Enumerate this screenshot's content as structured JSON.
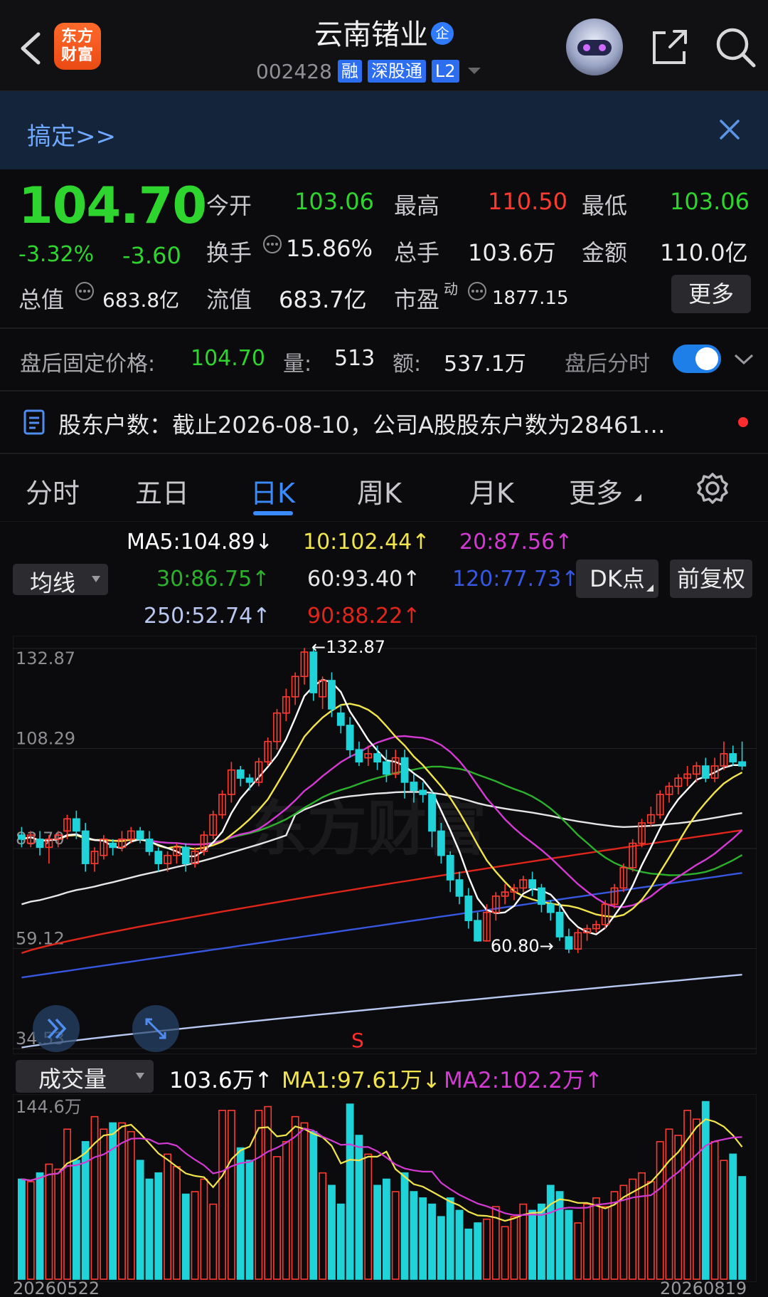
{
  "header": {
    "logo_text": "东方财富",
    "stock_name": "云南锗业",
    "qi_badge": "企",
    "code": "002428",
    "tags": [
      "融",
      "深股通",
      "L2"
    ]
  },
  "banner": {
    "text": "搞定>>"
  },
  "quote": {
    "price": "104.70",
    "change_pct": "-3.32%",
    "change": "-3.60",
    "open_label": "今开",
    "open": "103.06",
    "high_label": "最高",
    "high": "110.50",
    "low_label": "最低",
    "low": "103.06",
    "turnover_label": "换手",
    "turnover": "15.86%",
    "volume_label": "总手",
    "volume": "103.6万",
    "amount_label": "金额",
    "amount": "110.0亿",
    "mktcap_label": "总值",
    "mktcap": "683.8亿",
    "float_label": "流值",
    "float": "683.7亿",
    "pe_label": "市盈",
    "pe_sup": "动",
    "pe": "1877.15",
    "more_label": "更多"
  },
  "after_hours": {
    "label": "盘后固定价格:",
    "price": "104.70",
    "vol_label": "量:",
    "vol": "513",
    "amt_label": "额:",
    "amt": "537.1万",
    "tick_label": "盘后分时"
  },
  "notice": {
    "text": "股东户数：截止2026-08-10，公司A股股东户数为28461…"
  },
  "tabs": [
    "分时",
    "五日",
    "日K",
    "周K",
    "月K",
    "更多"
  ],
  "ma_selector": "均线",
  "ma_values": {
    "ma5": "MA5:104.89↓",
    "ma10": "10:102.44↑",
    "ma20": "20:87.56↑",
    "ma30": "30:86.75↑",
    "ma60": "60:93.40↑",
    "ma120": "120:77.73↑",
    "ma250": "250:52.74↑",
    "ma90": "90:88.22↑"
  },
  "buttons": {
    "dk": "DK点",
    "adjust": "前复权"
  },
  "volume_panel": {
    "selector": "成交量",
    "value": "103.6万↑",
    "ma1": "MA1:97.61万↓",
    "ma2": "MA2:102.2万↑",
    "max_label": "144.6万"
  },
  "colors": {
    "up": "#ff3b30",
    "down": "#1fd3d8",
    "ma5": "#ffffff",
    "ma10": "#f2e44c",
    "ma20": "#d33ad3",
    "ma30": "#2bb12b",
    "ma60": "#e6e6e6",
    "ma90": "#e0261a",
    "ma120": "#3657e0",
    "ma250": "#b8c8f0",
    "accent": "#3a8bff"
  },
  "chart_data": {
    "type": "candlestick",
    "y_ticks": [
      "132.87",
      "108.29",
      "83.70",
      "59.12",
      "34.53"
    ],
    "ylim": [
      34.53,
      132.87
    ],
    "x_labels": [
      "20260522",
      "20260819"
    ],
    "annotations": {
      "max": "←132.87",
      "min": "60.80→",
      "signal": "S"
    },
    "candles": [
      [
        87,
        86,
        89,
        84
      ],
      [
        85,
        87,
        88,
        84
      ],
      [
        86,
        84,
        88,
        82
      ],
      [
        84,
        86,
        87,
        80
      ],
      [
        86,
        87,
        88,
        84
      ],
      [
        88,
        91,
        92,
        86
      ],
      [
        91,
        88,
        93,
        86
      ],
      [
        88,
        80,
        90,
        78
      ],
      [
        80,
        83,
        84,
        78
      ],
      [
        82,
        86,
        87,
        81
      ],
      [
        85,
        84,
        86,
        82
      ],
      [
        84,
        86,
        88,
        83
      ],
      [
        86,
        88,
        89,
        85
      ],
      [
        88,
        86,
        89,
        85
      ],
      [
        86,
        83,
        88,
        82
      ],
      [
        83,
        80,
        84,
        78
      ],
      [
        80,
        82,
        83,
        78
      ],
      [
        82,
        84,
        85,
        80
      ],
      [
        84,
        80,
        85,
        78
      ],
      [
        80,
        83,
        84,
        79
      ],
      [
        83,
        87,
        88,
        82
      ],
      [
        87,
        92,
        93,
        86
      ],
      [
        92,
        97,
        98,
        91
      ],
      [
        97,
        103,
        105,
        95
      ],
      [
        103,
        101,
        104,
        99
      ],
      [
        101,
        100,
        102,
        98
      ],
      [
        100,
        105,
        106,
        99
      ],
      [
        105,
        110,
        111,
        104
      ],
      [
        110,
        117,
        118,
        108
      ],
      [
        117,
        121,
        123,
        115
      ],
      [
        121,
        126,
        127,
        119
      ],
      [
        126,
        132,
        133,
        124
      ],
      [
        132,
        122,
        133,
        120
      ],
      [
        121,
        125,
        126,
        118
      ],
      [
        125,
        118,
        127,
        116
      ],
      [
        117,
        114,
        119,
        112
      ],
      [
        114,
        108,
        116,
        106
      ],
      [
        108,
        105,
        110,
        104
      ],
      [
        106,
        107,
        109,
        104
      ],
      [
        107,
        105,
        109,
        103
      ],
      [
        105,
        102,
        108,
        100
      ],
      [
        102,
        106,
        108,
        101
      ],
      [
        106,
        100,
        108,
        96
      ],
      [
        100,
        98,
        102,
        95
      ],
      [
        98,
        97,
        100,
        95
      ],
      [
        97,
        88,
        98,
        84
      ],
      [
        88,
        82,
        90,
        80
      ],
      [
        82,
        76,
        83,
        73
      ],
      [
        76,
        72,
        78,
        70
      ],
      [
        72,
        66,
        74,
        64
      ],
      [
        66,
        61,
        68,
        60.8
      ],
      [
        61,
        68,
        70,
        60.8
      ],
      [
        68,
        72,
        73,
        66
      ],
      [
        72,
        73,
        75,
        70
      ],
      [
        73,
        74,
        75,
        71
      ],
      [
        74,
        76,
        77,
        73
      ],
      [
        76,
        74,
        78,
        72
      ],
      [
        74,
        70,
        75,
        68
      ],
      [
        70,
        68,
        71,
        66
      ],
      [
        68,
        62,
        70,
        61
      ],
      [
        62,
        59,
        64,
        58
      ],
      [
        59,
        63,
        64,
        58
      ],
      [
        63,
        64,
        65,
        61
      ],
      [
        64,
        65,
        66,
        63
      ],
      [
        65,
        70,
        71,
        64
      ],
      [
        70,
        74,
        75,
        69
      ],
      [
        74,
        79,
        80,
        73
      ],
      [
        79,
        85,
        86,
        78
      ],
      [
        85,
        90,
        91,
        84
      ],
      [
        90,
        92,
        94,
        89
      ],
      [
        92,
        97,
        98,
        91
      ],
      [
        97,
        99,
        100,
        95
      ],
      [
        99,
        101,
        102,
        97
      ],
      [
        101,
        102,
        104,
        99
      ],
      [
        102,
        104,
        105,
        100
      ],
      [
        104,
        101,
        106,
        100
      ],
      [
        101,
        104,
        106,
        100
      ],
      [
        104,
        107,
        110,
        103
      ],
      [
        107,
        105,
        109,
        104
      ],
      [
        105,
        104,
        110,
        103
      ]
    ],
    "ma_series_desc": [
      "MA5",
      "MA10",
      "MA20",
      "MA30",
      "MA60",
      "MA90",
      "MA120",
      "MA250"
    ],
    "volume": {
      "ylim": [
        0,
        144.6
      ],
      "values": [
        80,
        78,
        85,
        92,
        88,
        120,
        95,
        110,
        130,
        120,
        125,
        125,
        118,
        95,
        80,
        85,
        100,
        90,
        68,
        70,
        80,
        60,
        135,
        135,
        105,
        95,
        135,
        138,
        98,
        110,
        130,
        125,
        118,
        85,
        75,
        60,
        140,
        115,
        100,
        75,
        80,
        70,
        85,
        70,
        65,
        60,
        50,
        65,
        55,
        40,
        45,
        48,
        58,
        42,
        50,
        60,
        55,
        60,
        75,
        70,
        55,
        45,
        60,
        65,
        58,
        70,
        75,
        80,
        85,
        78,
        110,
        120,
        115,
        135,
        128,
        142,
        110,
        95,
        100,
        82
      ]
    }
  }
}
